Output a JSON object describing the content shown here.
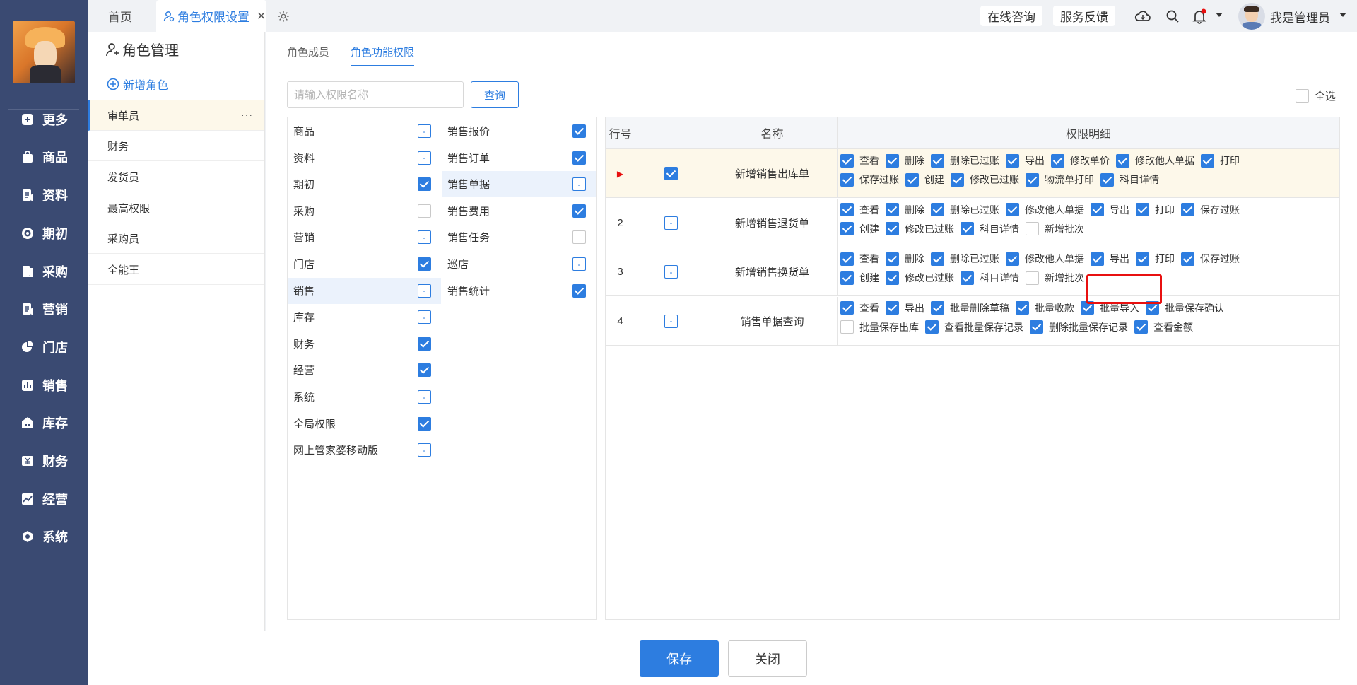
{
  "sidebar": {
    "items": [
      {
        "label": "更多",
        "icon": "plus-square-icon"
      },
      {
        "label": "商品",
        "icon": "bag-icon"
      },
      {
        "label": "资料",
        "icon": "document-icon"
      },
      {
        "label": "期初",
        "icon": "target-icon"
      },
      {
        "label": "采购",
        "icon": "book-icon"
      },
      {
        "label": "营销",
        "icon": "document-icon"
      },
      {
        "label": "门店",
        "icon": "pie-icon"
      },
      {
        "label": "销售",
        "icon": "bar-chart-icon"
      },
      {
        "label": "库存",
        "icon": "warehouse-icon"
      },
      {
        "label": "财务",
        "icon": "yen-icon"
      },
      {
        "label": "经营",
        "icon": "line-chart-icon"
      },
      {
        "label": "系统",
        "icon": "hexagon-icon"
      }
    ]
  },
  "tabs": {
    "home": "首页",
    "active": "角色权限设置"
  },
  "header": {
    "consult": "在线咨询",
    "feedback": "服务反馈",
    "user": "我是管理员"
  },
  "leftpanel": {
    "title": "角色管理",
    "add": "新增角色",
    "roles": [
      "审单员",
      "财务",
      "发货员",
      "最高权限",
      "采购员",
      "全能王"
    ],
    "more": "···"
  },
  "main": {
    "subtabs": [
      "角色成员",
      "角色功能权限"
    ],
    "search_placeholder": "请输入权限名称",
    "query": "查询",
    "select_all": "全选"
  },
  "categories_left": [
    {
      "label": "商品",
      "state": "partial"
    },
    {
      "label": "资料",
      "state": "partial"
    },
    {
      "label": "期初",
      "state": "checked"
    },
    {
      "label": "采购",
      "state": "unchecked"
    },
    {
      "label": "营销",
      "state": "partial"
    },
    {
      "label": "门店",
      "state": "checked"
    },
    {
      "label": "销售",
      "state": "partial"
    },
    {
      "label": "库存",
      "state": "partial"
    },
    {
      "label": "财务",
      "state": "checked"
    },
    {
      "label": "经营",
      "state": "checked"
    },
    {
      "label": "系统",
      "state": "partial"
    },
    {
      "label": "全局权限",
      "state": "checked"
    },
    {
      "label": "网上管家婆移动版",
      "state": "partial"
    }
  ],
  "categories_right": [
    {
      "label": "销售报价",
      "state": "checked"
    },
    {
      "label": "销售订单",
      "state": "checked"
    },
    {
      "label": "销售单据",
      "state": "partial"
    },
    {
      "label": "销售费用",
      "state": "checked"
    },
    {
      "label": "销售任务",
      "state": "unchecked"
    },
    {
      "label": "巡店",
      "state": "partial"
    },
    {
      "label": "销售统计",
      "state": "checked"
    }
  ],
  "grid": {
    "headers": {
      "row": "行号",
      "name": "名称",
      "detail": "权限明细"
    },
    "rows": [
      {
        "no": "▶",
        "name": "新增销售出库单",
        "check": "checked",
        "lines": [
          [
            [
              "查看",
              "checked"
            ],
            [
              "删除",
              "checked"
            ],
            [
              "删除已过账",
              "checked"
            ],
            [
              "导出",
              "checked"
            ],
            [
              "修改单价",
              "checked"
            ],
            [
              "修改他人单据",
              "checked"
            ],
            [
              "打印",
              "checked"
            ]
          ],
          [
            [
              "保存过账",
              "checked"
            ],
            [
              "创建",
              "checked"
            ],
            [
              "修改已过账",
              "checked"
            ],
            [
              "物流单打印",
              "checked"
            ],
            [
              "科目详情",
              "checked"
            ]
          ]
        ]
      },
      {
        "no": "2",
        "name": "新增销售退货单",
        "check": "partial",
        "lines": [
          [
            [
              "查看",
              "checked"
            ],
            [
              "删除",
              "checked"
            ],
            [
              "删除已过账",
              "checked"
            ],
            [
              "修改他人单据",
              "checked"
            ],
            [
              "导出",
              "checked"
            ],
            [
              "打印",
              "checked"
            ],
            [
              "保存过账",
              "checked"
            ]
          ],
          [
            [
              "创建",
              "checked"
            ],
            [
              "修改已过账",
              "checked"
            ],
            [
              "科目详情",
              "checked"
            ],
            [
              "新增批次",
              "unchecked"
            ]
          ]
        ]
      },
      {
        "no": "3",
        "name": "新增销售换货单",
        "check": "partial",
        "lines": [
          [
            [
              "查看",
              "checked"
            ],
            [
              "删除",
              "checked"
            ],
            [
              "删除已过账",
              "checked"
            ],
            [
              "修改他人单据",
              "checked"
            ],
            [
              "导出",
              "checked"
            ],
            [
              "打印",
              "checked"
            ],
            [
              "保存过账",
              "checked"
            ]
          ],
          [
            [
              "创建",
              "checked"
            ],
            [
              "修改已过账",
              "checked"
            ],
            [
              "科目详情",
              "checked"
            ],
            [
              "新增批次",
              "unchecked"
            ]
          ]
        ]
      },
      {
        "no": "4",
        "name": "销售单据查询",
        "check": "partial",
        "lines": [
          [
            [
              "查看",
              "checked"
            ],
            [
              "导出",
              "checked"
            ],
            [
              "批量删除草稿",
              "checked"
            ],
            [
              "批量收款",
              "checked"
            ],
            [
              "批量导入",
              "checked"
            ],
            [
              "批量保存确认",
              "checked"
            ]
          ],
          [
            [
              "批量保存出库",
              "unchecked"
            ],
            [
              "查看批量保存记录",
              "checked"
            ],
            [
              "删除批量保存记录",
              "checked"
            ],
            [
              "查看金额",
              "checked"
            ]
          ]
        ]
      }
    ]
  },
  "footer": {
    "save": "保存",
    "close": "关闭"
  },
  "colors": {
    "accent": "#2d7de0",
    "sidebar": "#3a4a72",
    "highlight": "#e81010"
  }
}
